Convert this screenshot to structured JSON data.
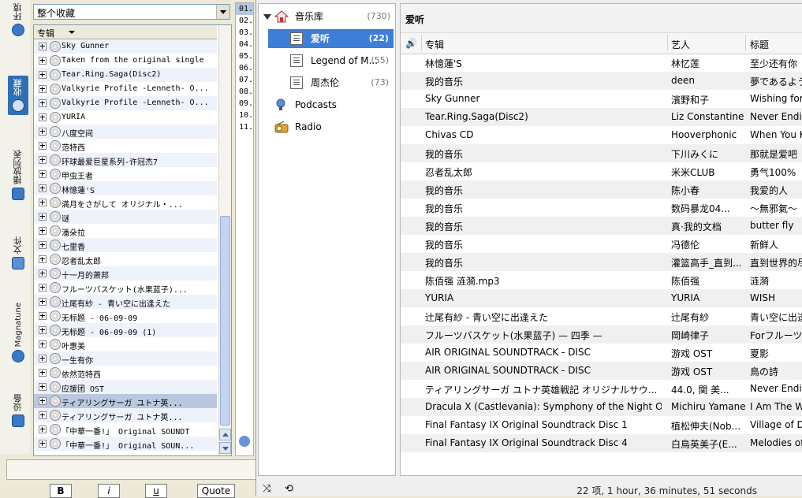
{
  "left_tabs": [
    {
      "label": "环境",
      "icon": "info-icon"
    },
    {
      "label": "收藏",
      "icon": "collection-icon",
      "selected": true
    },
    {
      "label": "播放列表",
      "icon": "playlist-icon"
    },
    {
      "label": "文件",
      "icon": "file-icon"
    },
    {
      "label": "Magnatune",
      "icon": "magnatune-icon"
    },
    {
      "label": "设备",
      "icon": "device-icon"
    }
  ],
  "collection": {
    "scope_select": "整个收藏",
    "column_header": "专辑",
    "albums": [
      "Sky Gunner",
      "Taken from the original single",
      "Tear.Ring.Saga(Disc2)",
      "Valkyrie Profile -Lenneth- O...",
      "Valkyrie Profile -Lenneth- O...",
      "YURIA",
      "八度空间",
      "范特西",
      "环球最爱巨星系列-许冠杰7",
      "甲虫王者",
      "林憶蓮'S",
      "満月をさがして オリジナル・...",
      "谜",
      "潘朵拉",
      "七里香",
      "忍者乱太郎",
      "十一月的萧邦",
      "フルーツバスケット(水果蓝子)...",
      "辻尾有紗 - 青い空に出逢えた",
      "无标题 - 06-09-09",
      "无标题 - 06-09-09 (1)",
      "叶惠美",
      "一生有你",
      "依然范特西",
      "应援团 OST",
      "ティアリングサーガ ユトナ英...",
      "ティアリングサーガ ユトナ英...",
      "「中華一番!」 Original SOUNDT",
      "「中華一番!」 Original SOUN..."
    ]
  },
  "track_numbers": [
    "01.",
    "02.",
    "03.",
    "04.",
    "05.",
    "06.",
    "07.",
    "08.",
    "09.",
    "10.",
    "11."
  ],
  "editor_buttons": {
    "bold": "B",
    "italic": "i",
    "underline": "u",
    "quote": "Quote"
  },
  "player": {
    "sources": [
      {
        "label": "音乐库",
        "count": "(730)"
      },
      {
        "label": "爱听",
        "count": "(22)"
      },
      {
        "label": "Legend of M...",
        "count": "(55)"
      },
      {
        "label": "周杰伦",
        "count": "(73)"
      },
      {
        "label": "Podcasts",
        "count": ""
      },
      {
        "label": "Radio",
        "count": ""
      }
    ],
    "playlist_title": "爱听",
    "columns": {
      "album": "专辑",
      "artist": "艺人",
      "title": "标题"
    },
    "tracks": [
      {
        "album": "林憶蓮'S",
        "artist": "林忆莲",
        "title": "至少还有你"
      },
      {
        "album": "我的音乐",
        "artist": "deen",
        "title": "夢であるように"
      },
      {
        "album": "Sky Gunner",
        "artist": "濱野和子",
        "title": "Wishing for a"
      },
      {
        "album": "Tear.Ring.Saga(Disc2)",
        "artist": "Liz Constantine",
        "title": "Never Ending"
      },
      {
        "album": "Chivas CD",
        "artist": "Hooverphonic",
        "title": "When You Kno"
      },
      {
        "album": "我的音乐",
        "artist": "下川みくに",
        "title": "那就是爱吧"
      },
      {
        "album": "忍者乱太郎",
        "artist": "米米CLUB",
        "title": "勇气100%"
      },
      {
        "album": "我的音乐",
        "artist": "陈小春",
        "title": "我爱的人"
      },
      {
        "album": "我的音乐",
        "artist": "数码暴龙04...",
        "title": "～無邪氣～"
      },
      {
        "album": "我的音乐",
        "artist": "真·我的文档",
        "title": "butter fly"
      },
      {
        "album": "我的音乐",
        "artist": "冯德伦",
        "title": "新鲜人"
      },
      {
        "album": "我的音乐",
        "artist": "灌篮高手_直到...",
        "title": "直到世界的尽"
      },
      {
        "album": "陈佰强 涟漪.mp3",
        "artist": "陈佰强",
        "title": "涟漪"
      },
      {
        "album": "YURIA",
        "artist": "YURIA",
        "title": "WISH"
      },
      {
        "album": "辻尾有紗 - 青い空に出逢えた",
        "artist": "辻尾有紗",
        "title": "青い空に出逢"
      },
      {
        "album": "フルーツバスケット(水果蓝子) — 四季 —",
        "artist": "岡崎律子",
        "title": "Forフルーツ"
      },
      {
        "album": "AIR ORIGINAL SOUNDTRACK - DISC",
        "artist": "游戏 OST",
        "title": "夏影"
      },
      {
        "album": "AIR ORIGINAL SOUNDTRACK - DISC",
        "artist": "游戏 OST",
        "title": "鳥の詩"
      },
      {
        "album": "ティアリングサーガ ユトナ英雄戦記 オリジナルサウ...",
        "artist": "44.0, 関 美...",
        "title": "Never Ending"
      },
      {
        "album": "Dracula X (Castlevania): Symphony of the Night OST",
        "artist": "Michiru Yamane",
        "title": "I Am The Wi"
      },
      {
        "album": "Final Fantasy IX Original Soundtrack Disc 1",
        "artist": "植松伸夫(Nob...",
        "title": "Village of Da"
      },
      {
        "album": "Final Fantasy IX Original Soundtrack Disc 4",
        "artist": "白鳥英美子(E...",
        "title": "Melodies of L"
      }
    ],
    "status": "22 项, 1 hour, 36 minutes, 51 seconds"
  }
}
